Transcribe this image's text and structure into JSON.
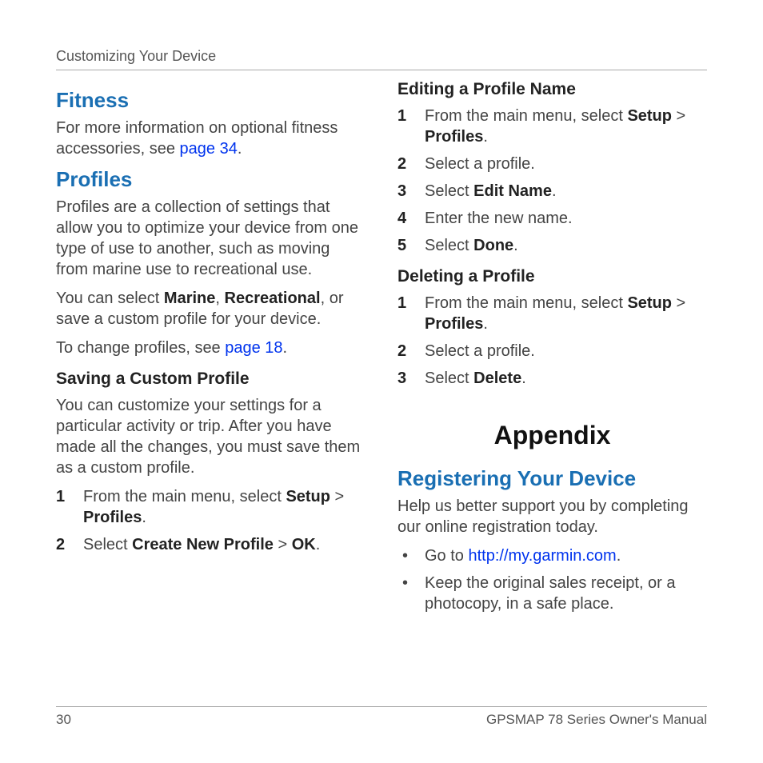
{
  "header": {
    "title": "Customizing Your Device"
  },
  "left": {
    "fitness": {
      "heading": "Fitness",
      "para_pre": "For more information on optional fitness accessories, see ",
      "link": "page 34",
      "para_post": "."
    },
    "profiles": {
      "heading": "Profiles",
      "para1": "Profiles are a collection of settings that allow you to optimize your device from one type of use to another, such as moving from marine use to recreational use.",
      "para2_pre": "You can select ",
      "marine": "Marine",
      "comma1": ", ",
      "recreational": "Recreational",
      "para2_post": ", or save a custom profile for your device.",
      "para3_pre": "To change profiles, see ",
      "para3_link": "page 18",
      "para3_post": "."
    },
    "saving": {
      "heading": "Saving a Custom Profile",
      "intro": "You can customize your settings for a particular activity or trip. After you have made all the changes, you must save them as a custom profile.",
      "step1_pre": "From the main menu, select ",
      "step1_setup": "Setup",
      "step1_gt": " > ",
      "step1_profiles": "Profiles",
      "step1_post": ".",
      "step2_pre": "Select ",
      "step2_create": "Create New Profile",
      "step2_gt": " > ",
      "step2_ok": "OK",
      "step2_post": "."
    }
  },
  "right": {
    "editing": {
      "heading": "Editing a Profile Name",
      "step1_pre": "From the main menu, select ",
      "step1_setup": "Setup",
      "step1_gt": " > ",
      "step1_profiles": "Profiles",
      "step1_post": ".",
      "step2": "Select a profile.",
      "step3_pre": "Select ",
      "step3_edit": "Edit Name",
      "step3_post": ".",
      "step4": "Enter the new name.",
      "step5_pre": "Select ",
      "step5_done": "Done",
      "step5_post": "."
    },
    "deleting": {
      "heading": "Deleting a Profile",
      "step1_pre": "From the main menu, select ",
      "step1_setup": "Setup",
      "step1_gt": " > ",
      "step1_profiles": "Profiles",
      "step1_post": ".",
      "step2": "Select a profile.",
      "step3_pre": "Select ",
      "step3_delete": "Delete",
      "step3_post": "."
    },
    "appendix": {
      "heading": "Appendix"
    },
    "registering": {
      "heading": "Registering Your Device",
      "intro": "Help us better support you by completing our online registration today.",
      "b1_pre": "Go to ",
      "b1_link": "http://my.garmin.com",
      "b1_post": ".",
      "b2": "Keep the original sales receipt, or a photocopy, in a safe place."
    }
  },
  "footer": {
    "page": "30",
    "doc": "GPSMAP 78 Series Owner's Manual"
  }
}
